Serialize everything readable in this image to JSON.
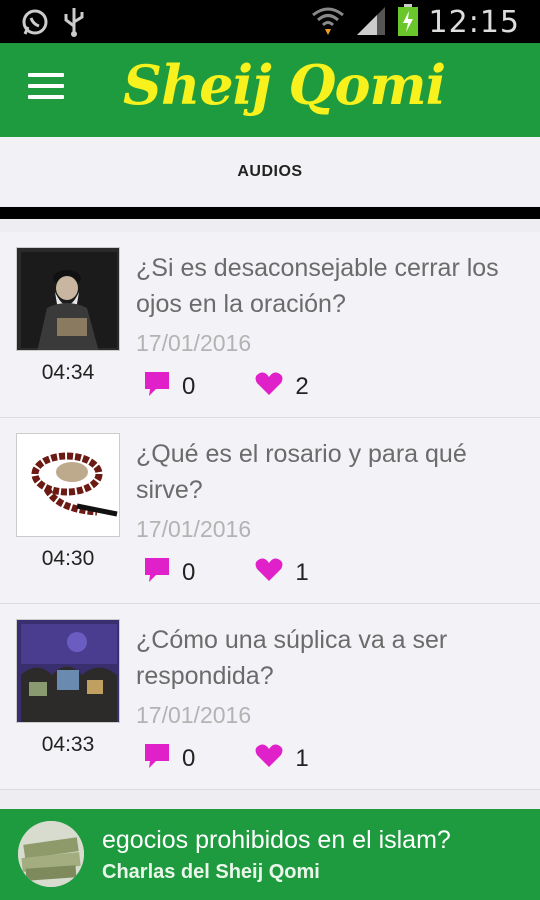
{
  "status_bar": {
    "time": "12:15"
  },
  "app_bar": {
    "title": "Sheij Qomi"
  },
  "tabs": [
    {
      "label": "AUDIOS"
    }
  ],
  "items": [
    {
      "title": "¿Si es desaconsejable cerrar los ojos en la oración?",
      "date": "17/01/2016",
      "duration": "04:34",
      "comments": "0",
      "likes": "2"
    },
    {
      "title": "¿Qué es el rosario y para qué sirve?",
      "date": "17/01/2016",
      "duration": "04:30",
      "comments": "0",
      "likes": "1"
    },
    {
      "title": "¿Cómo una súplica va a ser respondida?",
      "date": "17/01/2016",
      "duration": "04:33",
      "comments": "0",
      "likes": "1"
    }
  ],
  "now_playing": {
    "title": "egocios prohibidos en el islam?",
    "subtitle": "Charlas del Sheij Qomi"
  },
  "colors": {
    "app_bar": "#1f9b3f",
    "title": "#f7f21e",
    "accent_icons": "#e020c8"
  }
}
